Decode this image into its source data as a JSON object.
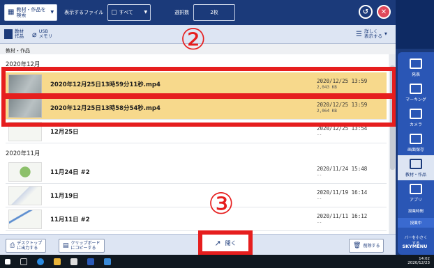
{
  "toolbar": {
    "material_search_label": "教材・作品を\n検索",
    "display_file_label": "表示するファイル",
    "filter_value": "すべて",
    "selection_count_label": "選択数",
    "selection_count_value": "2枚"
  },
  "subbar": {
    "material_label": "教材\n作品",
    "usb_label": "USB\nメモリ",
    "detail_view_label": "詳しく\n表示する"
  },
  "breadcrumb": "教材・作品",
  "groups": [
    {
      "header": "2020年12月"
    },
    {
      "header": "2020年11月"
    }
  ],
  "rows": [
    {
      "name": "2020年12月25日13時59分11秒.mp4",
      "date": "2020/12/25 13:59",
      "size": "2,043 KB",
      "selected": true
    },
    {
      "name": "2020年12月25日13時58分54秒.mp4",
      "date": "2020/12/25 13:59",
      "size": "2,064 KB",
      "selected": true
    },
    {
      "name": "12月25日",
      "date": "2020/12/25 13:54",
      "size": "--",
      "selected": false
    },
    {
      "name": "11月24日 #2",
      "date": "2020/11/24 15:48",
      "size": "--",
      "selected": false
    },
    {
      "name": "11月19日",
      "date": "2020/11/19 16:14",
      "size": "--",
      "selected": false
    },
    {
      "name": "11月11日 #2",
      "date": "2020/11/11 16:12",
      "size": "--",
      "selected": false
    }
  ],
  "annotations": {
    "step2": "②",
    "step3": "③"
  },
  "bottombar": {
    "desktop_btn": "デスクトップ\nに出力する",
    "clipboard_btn": "クリップボード\nにコピーする",
    "open_btn": "開く",
    "delete_btn": "削除する"
  },
  "sidebar": {
    "items": [
      "発表",
      "マーキング",
      "カメラ",
      "画面保存",
      "教材・作品",
      "アプリ"
    ],
    "jugyo_label": "授業時間",
    "connect_label": "授業中",
    "minimize_label": "バーを小さく\nする",
    "brand": "SKYMENU"
  },
  "taskbar": {
    "time": "14:02",
    "date": "2020/12/23"
  },
  "colors": {
    "accent": "#1b3a7a",
    "selected": "#f7d98c",
    "annotation": "#e61e1e"
  }
}
